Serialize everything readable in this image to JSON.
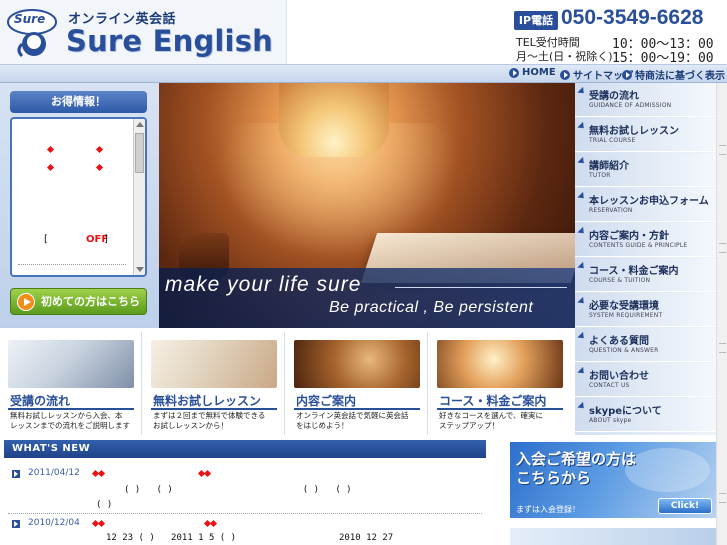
{
  "header": {
    "logo_badge": "Sure",
    "site_sub": "オンライン英会話",
    "site_name": "Sure English",
    "ip_badge": "IP電話",
    "phone": "050-3549-6628",
    "tel_label": "TEL受付時間",
    "tel_hours_1": "10：00～13：00",
    "tel_days": "月～土(日・祝除く)",
    "tel_hours_2": "15：00～19：00"
  },
  "topnav": {
    "home": "HOME",
    "sitemap": "サイトマップ",
    "tokushoho": "特商法に基づく表示"
  },
  "left": {
    "otoku_title": "お得情報！",
    "bracket_open": "[",
    "off_text": "OFF",
    "bracket_close": "]",
    "beginner_button": "初めての方はこちら"
  },
  "hero": {
    "line1": "make  your  life  sure",
    "line2": "Be  practical , Be  persistent"
  },
  "menu": [
    {
      "title": "受講の流れ",
      "sub": "GUIDANCE OF ADMISSION"
    },
    {
      "title": "無料お試しレッスン",
      "sub": "TRIAL COURSE"
    },
    {
      "title": "講師紹介",
      "sub": "TUTOR"
    },
    {
      "title": "本レッスンお申込フォーム",
      "sub": "RESERVATION"
    },
    {
      "title": "内容ご案内・方針",
      "sub": "CONTENTS GUIDE & PRINCIPLE"
    },
    {
      "title": "コース・料金ご案内",
      "sub": "COURSE & TUITION"
    },
    {
      "title": "必要な受講環境",
      "sub": "SYSTEM REQUIREMENT"
    },
    {
      "title": "よくある質問",
      "sub": "QUESTION & ANSWER"
    },
    {
      "title": "お問い合わせ",
      "sub": "CONTACT US"
    },
    {
      "title": "skypeについて",
      "sub": "ABOUT skype"
    }
  ],
  "features": [
    {
      "title": "受講の流れ",
      "desc1": "無料お試しレッスンから入会、本",
      "desc2": "レッスンまでの流れをご説明します"
    },
    {
      "title": "無料お試しレッスン",
      "desc1": "まずは２回まで無料で体験できる",
      "desc2": "お試しレッスンから！"
    },
    {
      "title": "内容ご案内",
      "desc1": "オンライン英会話で気軽に英会話",
      "desc2": "をはじめよう！"
    },
    {
      "title": "コース・料金ご案内",
      "desc1": "好きなコースを選んで、確実に",
      "desc2": "ステップアップ！"
    }
  ],
  "news": {
    "heading": "WHAT'S NEW",
    "items": [
      {
        "date": "2011/04/12",
        "line1": "( )   ( )                        ( )   ( )",
        "line2": "( )"
      },
      {
        "date": "2010/12/04",
        "line1": "12 23 ( )   2011 1 5 ( )                   2010 12 27",
        "line2": ""
      }
    ]
  },
  "join": {
    "line1": "入会ご希望の方は",
    "line2": "こちらから",
    "line3": "まずは入会登録！",
    "click": "Click!"
  },
  "colors": {
    "brand_blue": "#2a4f9a",
    "accent_red": "#e11111",
    "accent_green": "#5a9a1c"
  }
}
